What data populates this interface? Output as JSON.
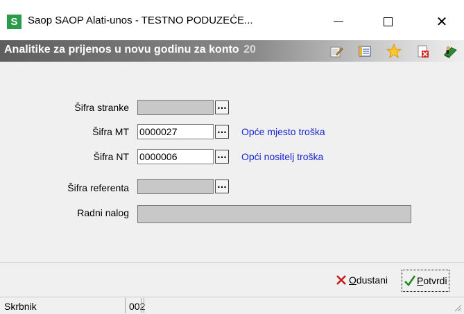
{
  "window": {
    "app_icon_letter": "S",
    "title": "Saop SAOP Alati-unos - TESTNO PODUZEĆE...",
    "minimize_icon": "minimize-icon",
    "maximize_icon": "maximize-icon",
    "close_glyph": "✕"
  },
  "header": {
    "title": "Analitike za prijenos u novu godinu za konto",
    "overlap_text": "20",
    "icons": [
      "edit-icon",
      "list-icon",
      "star-icon",
      "delete-icon",
      "exit-icon"
    ]
  },
  "form": {
    "fields": [
      {
        "label": "Šifra stranke",
        "value": "",
        "enabled": false,
        "has_button": true,
        "description": ""
      },
      {
        "label": "Šifra MT",
        "value": "0000027",
        "enabled": true,
        "has_button": true,
        "description": "Opće mjesto troška"
      },
      {
        "label": "Šifra NT",
        "value": "0000006",
        "enabled": true,
        "has_button": true,
        "description": "Opći nositelj troška"
      },
      {
        "label": "Šifra referenta",
        "value": "",
        "enabled": false,
        "has_button": true,
        "description": ""
      },
      {
        "label": "Radni nalog",
        "value": "",
        "enabled": false,
        "has_button": false,
        "description": ""
      }
    ],
    "browse_label": "..."
  },
  "buttons": {
    "cancel_first": "O",
    "cancel_rest": "dustani",
    "confirm_first": "P",
    "confirm_rest": "otvrdi"
  },
  "status": {
    "user": "Skrbnik",
    "code": "002"
  },
  "colors": {
    "desc_link": "#1a24d0",
    "app_icon": "#2a9c4b"
  }
}
